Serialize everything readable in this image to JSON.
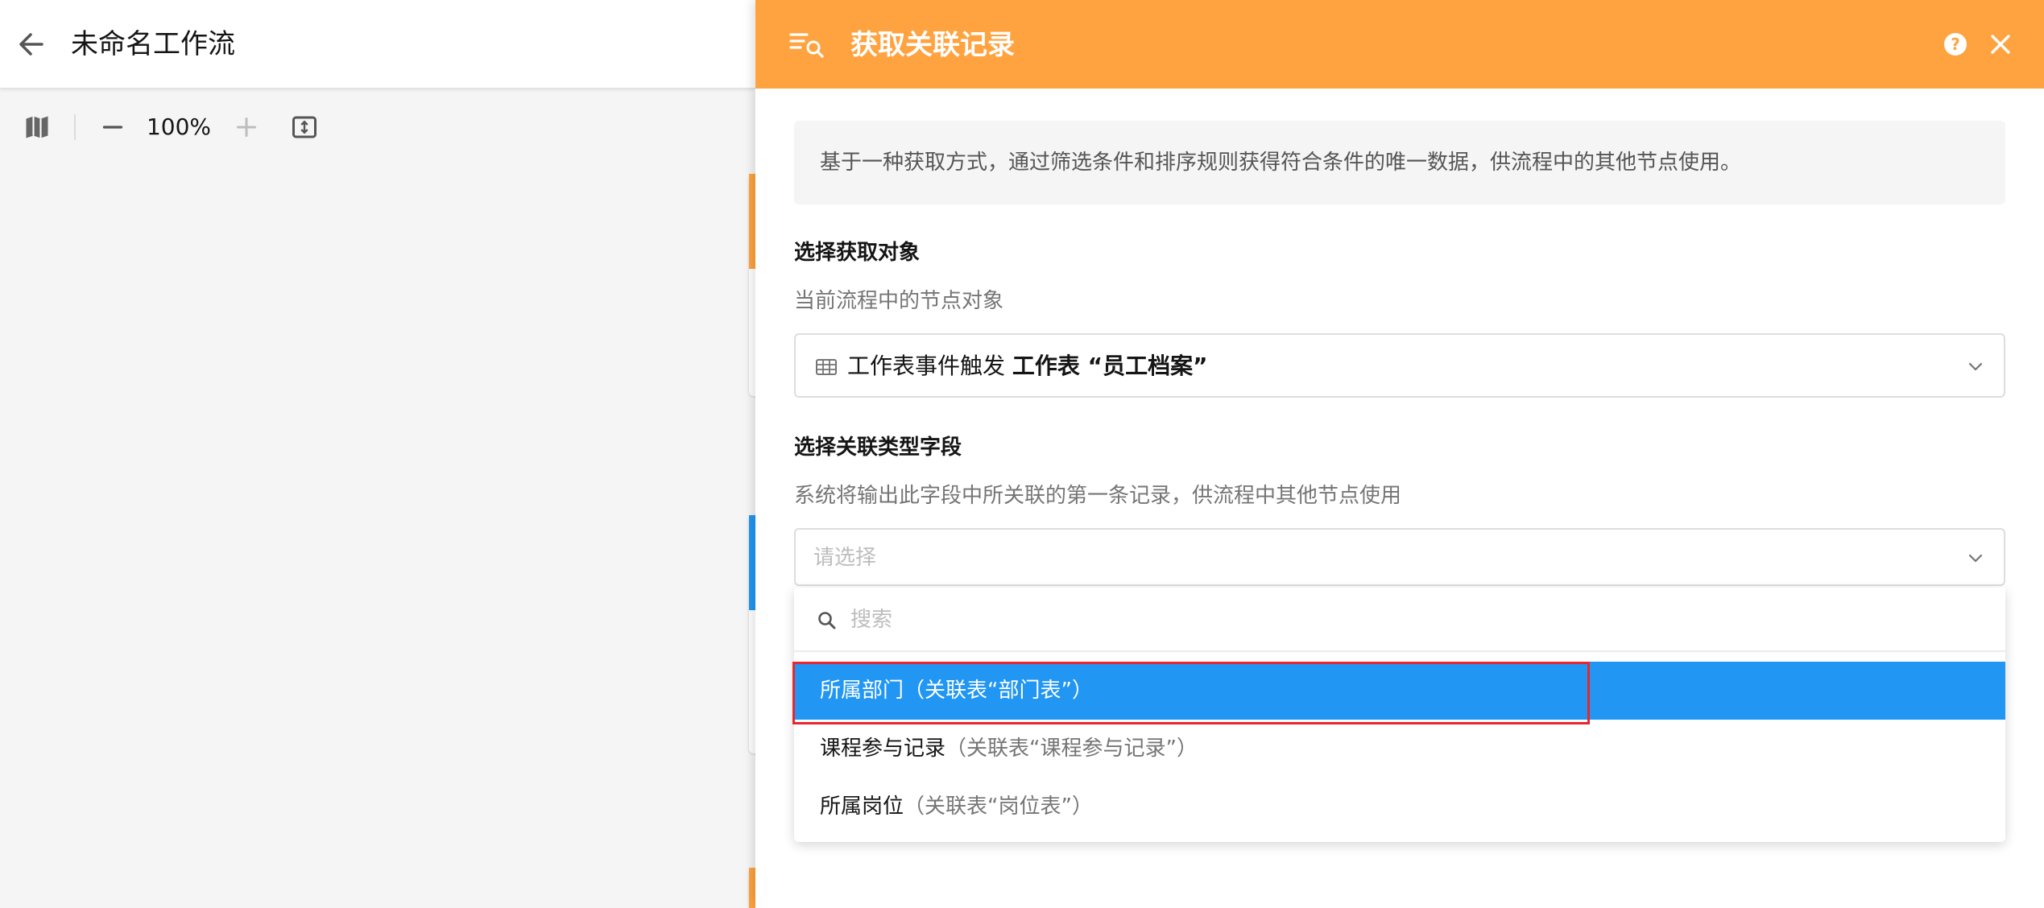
{
  "workflow": {
    "title": "未命名工作流",
    "zoom": "100%"
  },
  "panel": {
    "title": "获取关联记录",
    "description": "基于一种获取方式，通过筛选条件和排序规则获得符合条件的唯一数据，供流程中的其他节点使用。",
    "section1": {
      "title": "选择获取对象",
      "subtitle": "当前流程中的节点对象",
      "selected_prefix": "工作表事件触发",
      "selected_value": "工作表 “员工档案”"
    },
    "section2": {
      "title": "选择关联类型字段",
      "subtitle": "系统将输出此字段中所关联的第一条记录，供流程中其他节点使用",
      "placeholder": "请选择"
    },
    "dropdown": {
      "search_placeholder": "搜索",
      "options": [
        {
          "name": "所属部门",
          "relation": "（关联表“部门表”）",
          "selected": true
        },
        {
          "name": "课程参与记录",
          "relation": "（关联表“课程参与记录”）",
          "selected": false
        },
        {
          "name": "所属岗位",
          "relation": "（关联表“岗位表”）",
          "selected": false
        }
      ]
    }
  },
  "colors": {
    "header_orange": "#ffa340",
    "selected_blue": "#2196f3",
    "highlight_red": "#e8262b"
  },
  "icons": [
    "back-arrow-icon",
    "map-icon",
    "minus-icon",
    "plus-icon",
    "fit-screen-icon",
    "search-list-icon",
    "help-icon",
    "close-icon",
    "table-grid-icon",
    "chevron-down-icon",
    "search-icon"
  ]
}
